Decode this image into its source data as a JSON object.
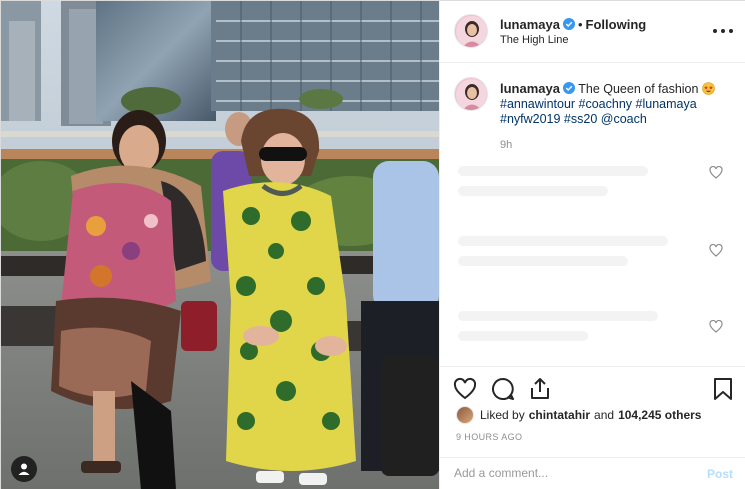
{
  "post": {
    "username": "lunamaya",
    "follow_separator": "•",
    "follow_status": "Following",
    "location": "The High Line",
    "more_label": "More options",
    "caption": {
      "username": "lunamaya",
      "text": "The Queen of fashion",
      "emoji": "star-struck-emoji",
      "hashtags_line": "#annawintour #coachny #lunamaya #nyfw2019 #ss20 @coach",
      "time": "9h"
    },
    "likes": {
      "prefix": "Liked by",
      "user": "chintatahir",
      "conjunction": "and",
      "count": "104,245 others"
    },
    "posted_ago": "9 HOURS AGO",
    "comment": {
      "placeholder": "Add a comment...",
      "post_label": "Post"
    }
  },
  "icons": {
    "verified": "verified-badge-icon",
    "like": "heart-icon",
    "comment": "comment-bubble-icon",
    "share": "share-icon",
    "save": "bookmark-icon",
    "user_tags": "user-tag-icon"
  },
  "colors": {
    "verified_blue": "#3897f0",
    "link_blue": "#003569",
    "post_button_disabled": "#b2dffc",
    "muted_text": "#8e8e8e"
  }
}
